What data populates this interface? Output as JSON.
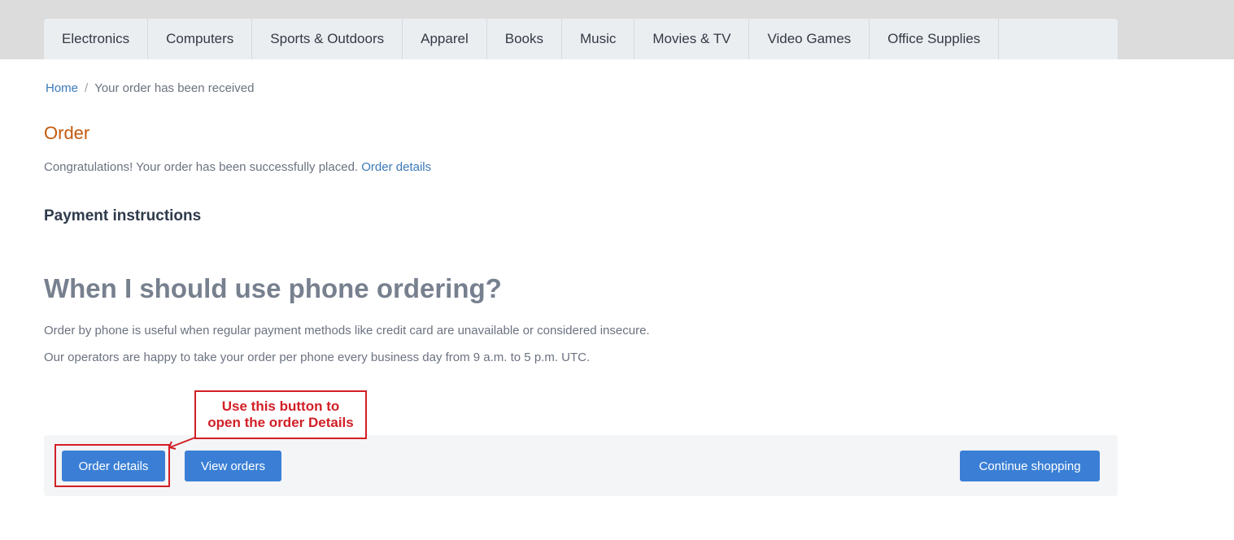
{
  "nav": {
    "items": [
      {
        "label": "Electronics"
      },
      {
        "label": "Computers"
      },
      {
        "label": "Sports & Outdoors"
      },
      {
        "label": "Apparel"
      },
      {
        "label": "Books"
      },
      {
        "label": "Music"
      },
      {
        "label": "Movies & TV"
      },
      {
        "label": "Video Games"
      },
      {
        "label": "Office Supplies"
      }
    ]
  },
  "breadcrumb": {
    "home": "Home",
    "separator": "/",
    "current": "Your order has been received"
  },
  "page": {
    "title": "Order",
    "congrats_text": "Congratulations! Your order has been successfully placed.",
    "congrats_link": "Order details",
    "payment_heading": "Payment instructions",
    "phone_heading": "When I should use phone ordering?",
    "paragraph1": "Order by phone is useful when regular payment methods like credit card are unavailable or considered insecure.",
    "paragraph2": "Our operators are happy to take your order per phone every business day from 9 a.m. to 5 p.m. UTC."
  },
  "annotation": {
    "line1": "Use this button to",
    "line2": "open the order Details",
    "color": "#d21f26",
    "arrow_icon": "arrow-left-down-icon"
  },
  "actions": {
    "order_details": "Order details",
    "view_orders": "View orders",
    "continue_shopping": "Continue shopping"
  },
  "colors": {
    "accent_button": "#3a7fd5",
    "link": "#3a79b8",
    "title": "#c35a0e"
  }
}
